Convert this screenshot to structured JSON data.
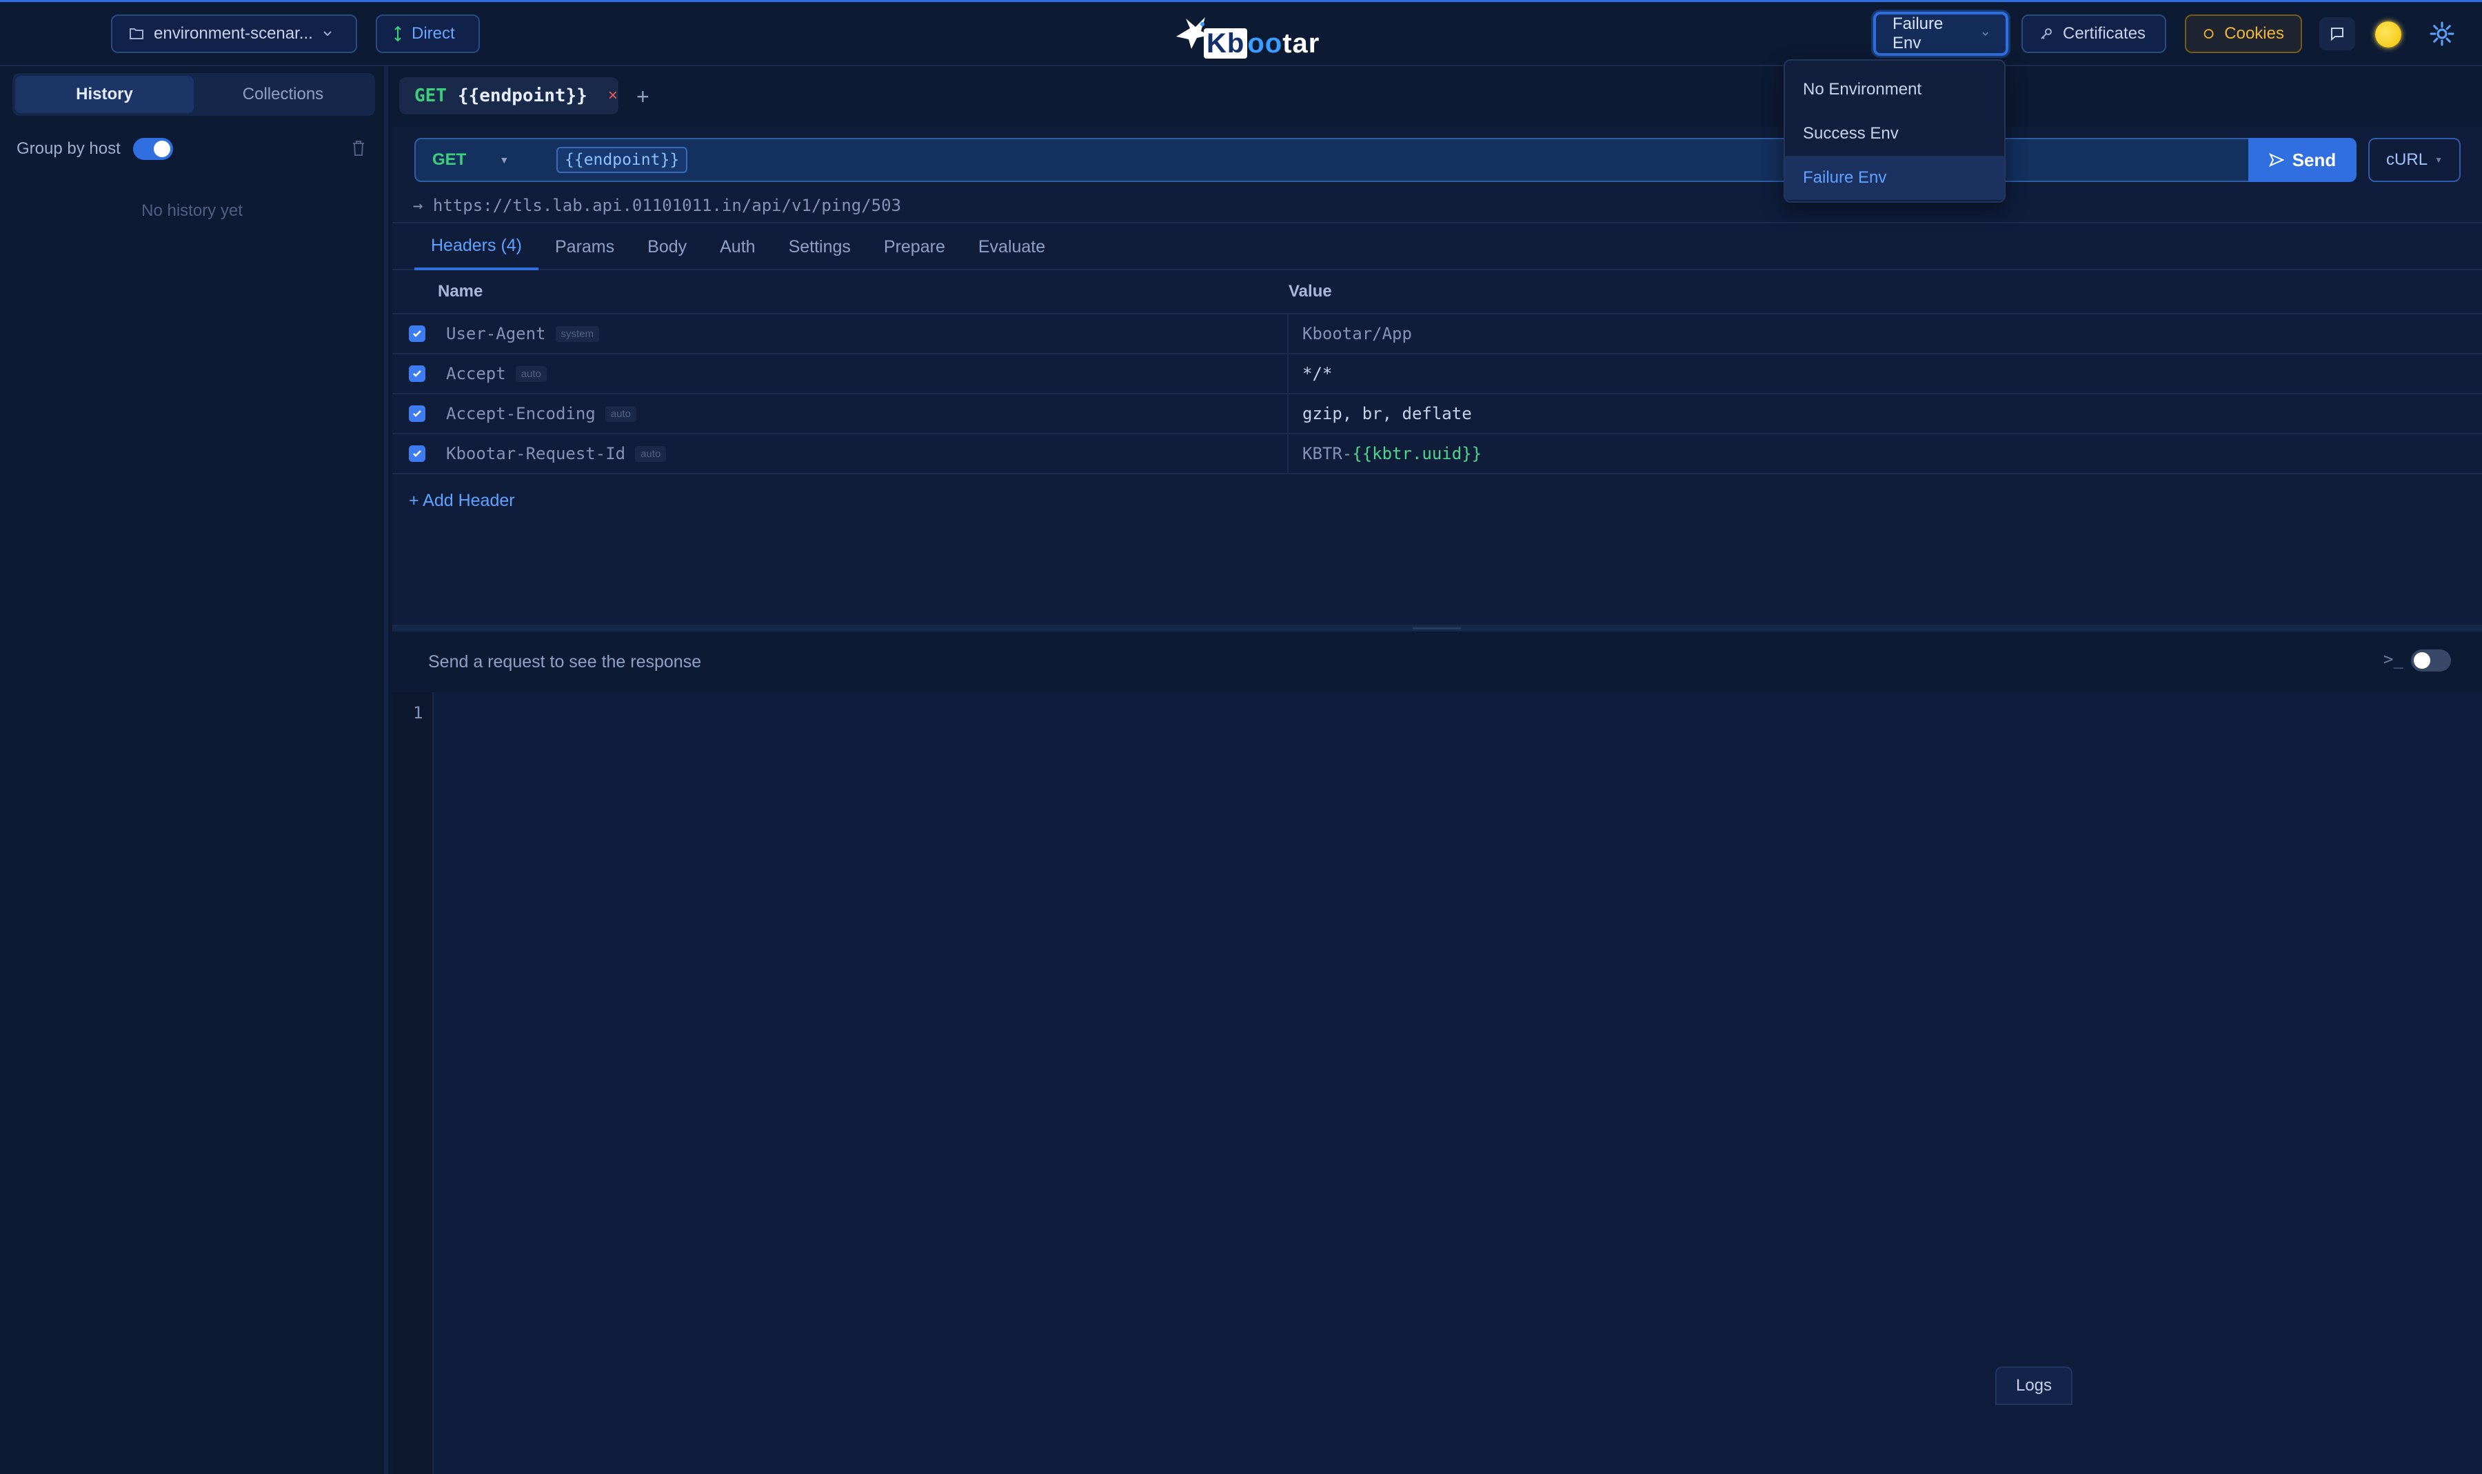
{
  "topbar": {
    "project_label": "environment-scenar...",
    "direct_label": "Direct",
    "logo": "Kbootar",
    "environment_label": "Failure Env",
    "certificates_label": "Certificates",
    "cookies_label": "Cookies"
  },
  "env_dropdown": {
    "items": [
      "No Environment",
      "Success Env",
      "Failure Env"
    ],
    "selected": "Failure Env"
  },
  "sidebar": {
    "tabs": [
      "History",
      "Collections"
    ],
    "active_tab": "History",
    "group_by_host_label": "Group by host",
    "group_by_host_on": true,
    "empty_message": "No history yet"
  },
  "request_tab": {
    "method": "GET",
    "name": "{{endpoint}}",
    "close": "×",
    "add": "+"
  },
  "url_bar": {
    "method": "GET",
    "token": "{{endpoint}}",
    "send_label": "Send",
    "curl_label": "cURL",
    "resolved_arrow": "→",
    "resolved_url": "https://tls.lab.api.01101011.in/api/v1/ping/503"
  },
  "subtabs": [
    "Headers (4)",
    "Params",
    "Body",
    "Auth",
    "Settings",
    "Prepare",
    "Evaluate"
  ],
  "headers_table": {
    "columns": [
      "Name",
      "Value"
    ],
    "rows": [
      {
        "name": "User-Agent",
        "tag": "system",
        "value": "Kbootar/App",
        "checked": true
      },
      {
        "name": "Accept",
        "tag": "auto",
        "value": "*/*",
        "checked": true
      },
      {
        "name": "Accept-Encoding",
        "tag": "auto",
        "value": "gzip, br, deflate",
        "checked": true
      },
      {
        "name": "Kbootar-Request-Id",
        "tag": "auto",
        "value_prefix": "KBTR-",
        "value_var": "{{kbtr.uuid}}",
        "checked": true
      }
    ],
    "add_label": "+ Add Header"
  },
  "response": {
    "placeholder": "Send a request to see the response",
    "terminal_glyph": ">_",
    "line_number": "1",
    "logs_label": "Logs"
  },
  "colors": {
    "accent": "#2f6fe0",
    "method_get": "#3ecf7a",
    "cookies": "#f1b63a",
    "background": "#0e1a33"
  }
}
